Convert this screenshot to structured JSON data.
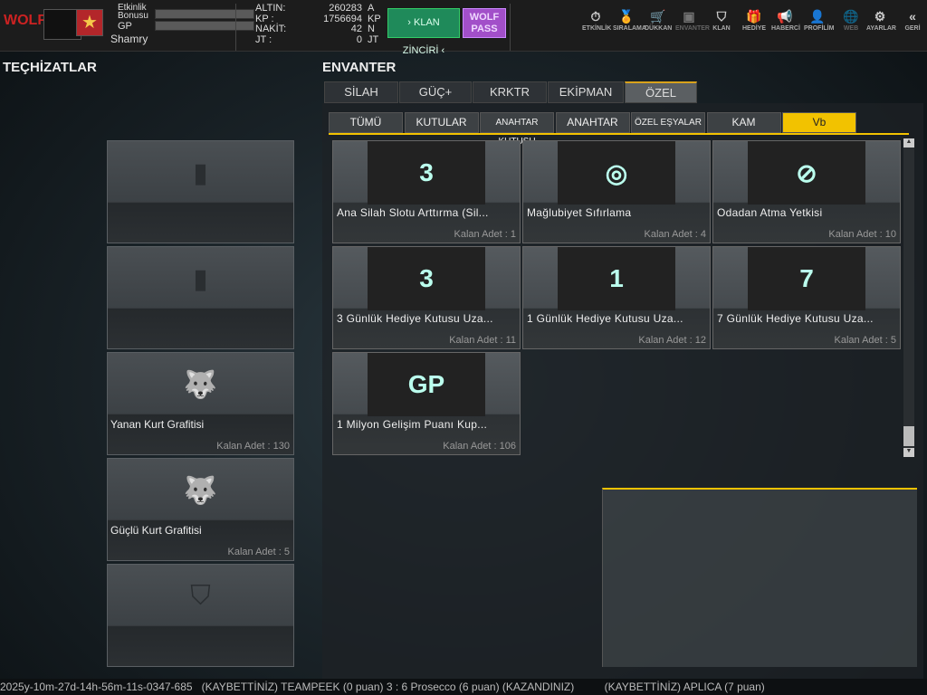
{
  "topbar": {
    "player_name": "Shamry",
    "event_bonus_label": "Etkinlik Bonusu",
    "gp_label": "GP",
    "currencies": [
      {
        "label": "ALTIN:",
        "value": "260283",
        "unit": "A"
      },
      {
        "label": "KP :",
        "value": "1756694",
        "unit": "KP"
      },
      {
        "label": "NAKİT:",
        "value": "42",
        "unit": "N"
      },
      {
        "label": "JT :",
        "value": "0",
        "unit": "JT"
      }
    ],
    "klan_zinciri": "› KLAN ZİNCİRİ ‹",
    "wolf_pass": "WOLF PASS",
    "nav": [
      {
        "label": "ETKİNLİK",
        "icon": "⏱"
      },
      {
        "label": "SIRALAMA",
        "icon": "🏅"
      },
      {
        "label": "DÜKKAN",
        "icon": "🛒"
      },
      {
        "label": "ENVANTER",
        "icon": "▣"
      },
      {
        "label": "KLAN",
        "icon": "⛉"
      },
      {
        "label": "HEDİYE",
        "icon": "🎁"
      },
      {
        "label": "HABERCİ",
        "icon": "📢"
      },
      {
        "label": "PROFİLİM",
        "icon": "👤"
      },
      {
        "label": "WEB",
        "icon": "🌐"
      },
      {
        "label": "AYARLAR",
        "icon": "⚙"
      },
      {
        "label": "GERİ",
        "icon": "«"
      }
    ]
  },
  "left": {
    "title": "TEÇHİZATLAR",
    "slots": [
      {
        "name": "",
        "count": "",
        "icon": "▮"
      },
      {
        "name": "",
        "count": "",
        "icon": "▮"
      },
      {
        "name": "Yanan Kurt Grafitisi",
        "count": "Kalan Adet : 130",
        "icon": "🐺"
      },
      {
        "name": "Güçlü Kurt Grafitisi",
        "count": "Kalan Adet : 5",
        "icon": "🐺"
      },
      {
        "name": "",
        "count": "",
        "icon": "⛉"
      }
    ]
  },
  "inventory": {
    "title": "ENVANTER",
    "tabs": [
      "SİLAH",
      "GÜÇ+",
      "KRKTR",
      "EKİPMAN",
      "ÖZEL"
    ],
    "active_tab": "ÖZEL",
    "subtabs": [
      "TÜMÜ",
      "KUTULAR",
      "ANAHTAR KUTUSU",
      "ANAHTAR",
      "ÖZEL EŞYALAR",
      "KAM",
      "Vb"
    ],
    "active_subtab": "Vb",
    "items": [
      {
        "name": "Ana Silah Slotu Arttırma (Sil...",
        "count": "Kalan Adet : 1",
        "icon": "3"
      },
      {
        "name": "Mağlubiyet  Sıfırlama",
        "count": "Kalan Adet : 4",
        "icon": "◎"
      },
      {
        "name": "Odadan Atma Yetkisi",
        "count": "Kalan Adet : 10",
        "icon": "⊘"
      },
      {
        "name": "3 Günlük Hediye Kutusu Uza...",
        "count": "Kalan Adet : 11",
        "icon": "3"
      },
      {
        "name": "1 Günlük Hediye Kutusu Uza...",
        "count": "Kalan Adet : 12",
        "icon": "1"
      },
      {
        "name": "7 Günlük Hediye Kutusu Uza...",
        "count": "Kalan Adet : 5",
        "icon": "7"
      },
      {
        "name": "1 Milyon Gelişim Puanı Kup...",
        "count": "Kalan Adet : 106",
        "icon": "GP"
      }
    ]
  },
  "ticker": {
    "text": "2025y-10m-27d-14h-56m-11s-0347-685   (KAYBETTİNİZ) TEAMPEEK (0 puan) 3 : 6 Prosecco (6 puan) (KAZANDINIZ)          (KAYBETTİNİZ) APLICA (7 puan)"
  },
  "colors": {
    "accent": "#f2c200",
    "klan": "#1f8a5a",
    "wolf": "#a24fc9"
  }
}
